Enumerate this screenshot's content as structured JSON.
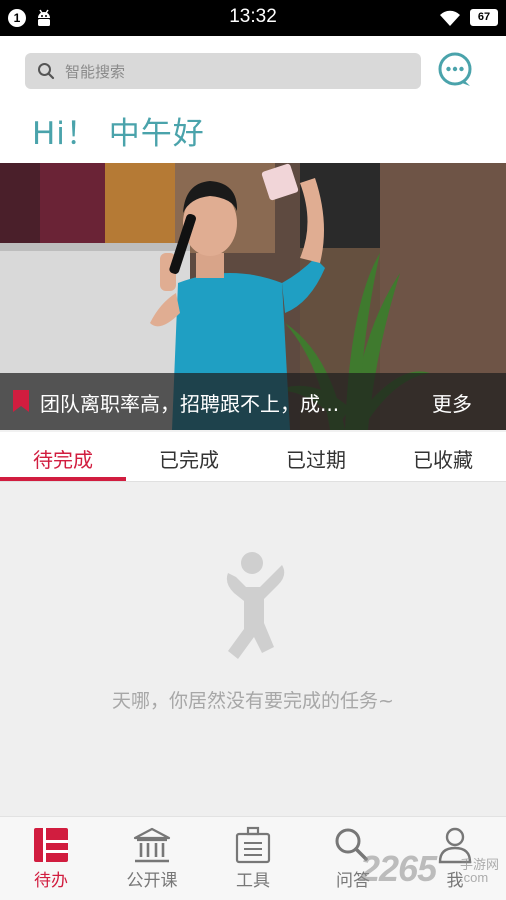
{
  "status_bar": {
    "notification_count": "1",
    "time": "13:32",
    "battery": "67"
  },
  "search": {
    "placeholder": "智能搜索"
  },
  "greeting": "Hi！ 中午好",
  "banner": {
    "caption": "团队离职率高，招聘跟不上，成...",
    "more_label": "更多"
  },
  "tabs": [
    {
      "label": "待完成",
      "active": true
    },
    {
      "label": "已完成",
      "active": false
    },
    {
      "label": "已过期",
      "active": false
    },
    {
      "label": "已收藏",
      "active": false
    }
  ],
  "empty_state": {
    "message": "天哪，你居然没有要完成的任务~"
  },
  "bottom_nav": [
    {
      "label": "待办",
      "icon": "todo-icon",
      "active": true
    },
    {
      "label": "公开课",
      "icon": "museum-icon",
      "active": false
    },
    {
      "label": "工具",
      "icon": "toolbox-icon",
      "active": false
    },
    {
      "label": "问答",
      "icon": "search-qa-icon",
      "active": false
    },
    {
      "label": "我",
      "icon": "user-icon",
      "active": false
    }
  ],
  "watermark": {
    "brand": "2265",
    "line1": "手游网",
    "line2": ".com"
  },
  "colors": {
    "accent": "#d11d3f",
    "greeting": "#4aa3ab"
  }
}
